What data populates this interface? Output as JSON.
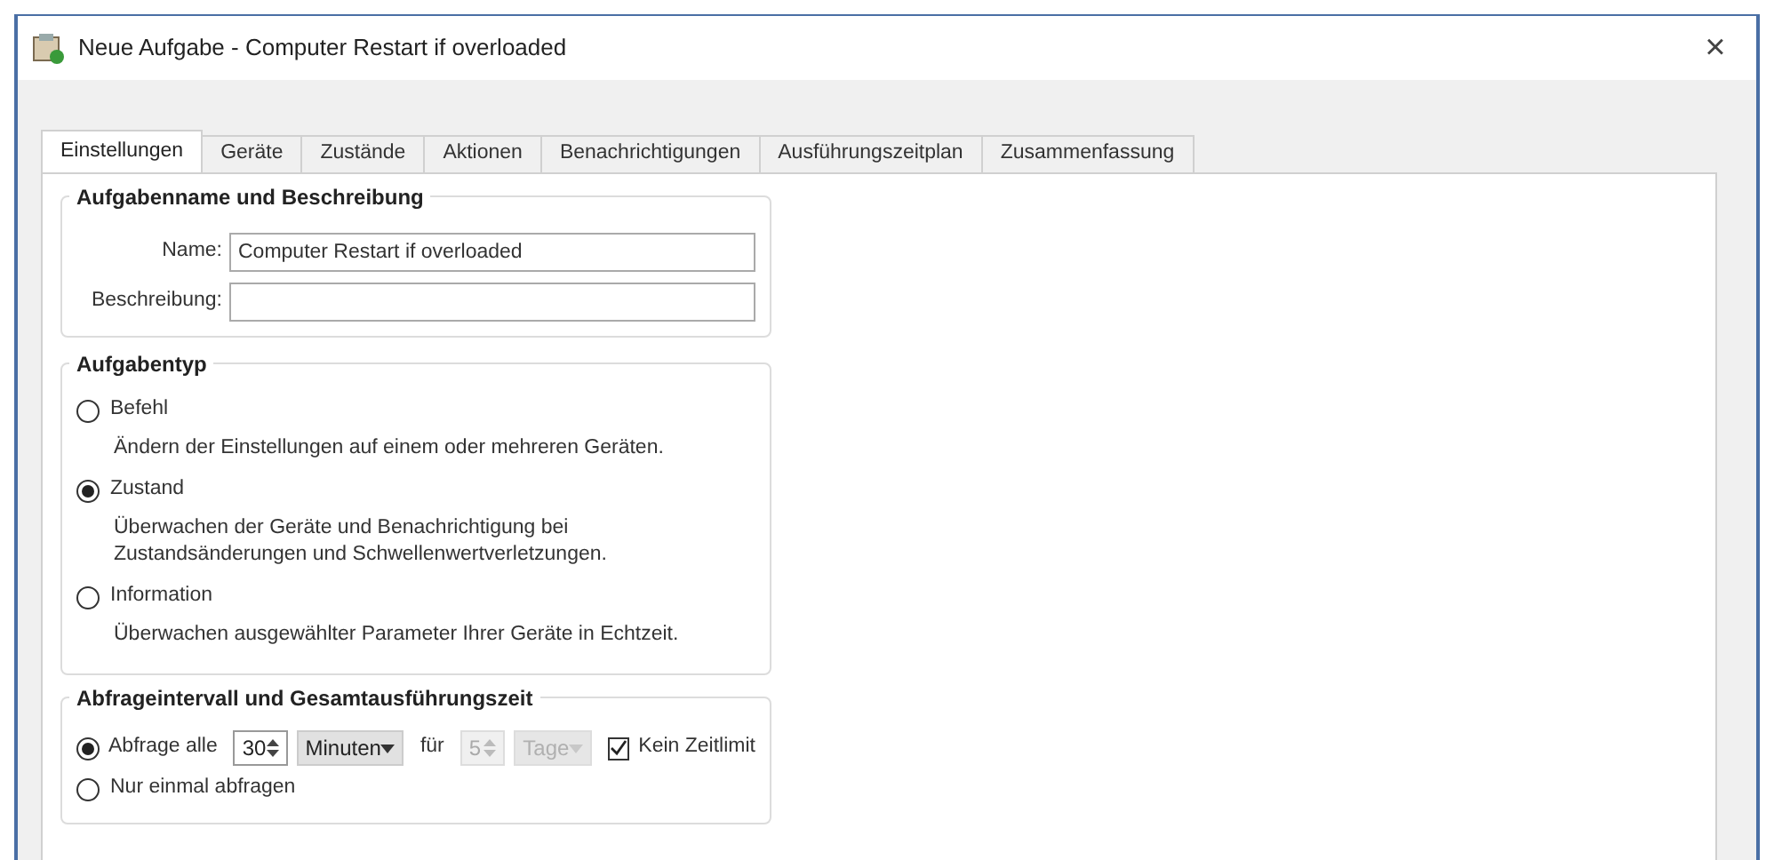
{
  "window": {
    "title": "Neue Aufgabe - Computer Restart if overloaded",
    "close": "×"
  },
  "tabs": [
    {
      "label": "Einstellungen",
      "selected": true
    },
    {
      "label": "Geräte",
      "selected": false
    },
    {
      "label": "Zustände",
      "selected": false
    },
    {
      "label": "Aktionen",
      "selected": false
    },
    {
      "label": "Benachrichtigungen",
      "selected": false
    },
    {
      "label": "Ausführungszeitplan",
      "selected": false
    },
    {
      "label": "Zusammenfassung",
      "selected": false
    }
  ],
  "name_group": {
    "title": "Aufgabenname und Beschreibung",
    "fields": [
      {
        "label": "Name:",
        "value": "Computer Restart if overloaded"
      },
      {
        "label": "Beschreibung:"
      }
    ]
  },
  "type_group": {
    "title": "Aufgabentyp",
    "options": [
      {
        "label": "Befehl",
        "selected": false,
        "description": "Ändern der Einstellungen auf einem oder mehreren Geräten."
      },
      {
        "label": "Zustand",
        "selected": true,
        "description": "Überwachen der Geräte und Benachrichtigung bei Zustandsänderungen und Schwellenwertverletzungen."
      },
      {
        "label": "Information",
        "selected": false,
        "description": "Überwachen ausgewählter Parameter Ihrer Geräte in Echtzeit."
      }
    ]
  },
  "interval_group": {
    "title": "Abfrageintervall und Gesamtausführungszeit",
    "repeat": {
      "label": "Abfrage alle",
      "selected": true,
      "interval": "30",
      "unit": "Minuten",
      "for_label": "für",
      "duration": "5",
      "duration_unit": "Tage",
      "duration_disabled": true,
      "no_limit": {
        "label": "Kein Zeitlimit",
        "checked": true
      }
    },
    "once": {
      "label": "Nur einmal abfragen",
      "selected": false
    }
  }
}
